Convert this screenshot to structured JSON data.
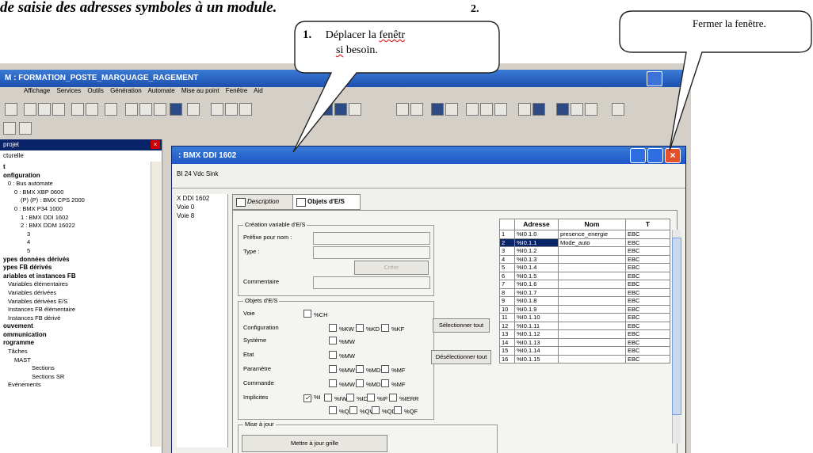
{
  "doc_heading": "de saisie des adresses symboles à un module.",
  "app": {
    "title": "M : FORMATION_POSTE_MARQUAGE_RAGEMENT",
    "menu": [
      "Affichage",
      "Services",
      "Outils",
      "Génération",
      "Automate",
      "Mise au point",
      "Fenêtre",
      "Aid"
    ]
  },
  "left_panel": {
    "title": "projet",
    "close": "×",
    "subtitle": "cturelle",
    "tree": [
      {
        "text": "t",
        "bold": true
      },
      {
        "text": "onfiguration",
        "bold": true
      },
      {
        "text": "0 : Bus automate",
        "bold": false
      },
      {
        "text": "0 : BMX XBP 0600",
        "bold": false
      },
      {
        "text": "(P) (P) : BMX CPS 2000",
        "bold": false
      },
      {
        "text": "0 : BMX P34 1000",
        "bold": false
      },
      {
        "text": "1 : BMX DDI 1602",
        "bold": false
      },
      {
        "text": "2 : BMX DDM 16022",
        "bold": false
      },
      {
        "text": "3",
        "bold": false
      },
      {
        "text": "4",
        "bold": false
      },
      {
        "text": "5",
        "bold": false
      },
      {
        "text": "ypes données dérivés",
        "bold": true
      },
      {
        "text": "ypes FB dérivés",
        "bold": true
      },
      {
        "text": "ariables et instances FB",
        "bold": true
      },
      {
        "text": "Variables élémentaires",
        "bold": false
      },
      {
        "text": "Variables dérivées",
        "bold": false
      },
      {
        "text": "Variables dérivées E/S",
        "bold": false
      },
      {
        "text": "Instances FB élémentaire",
        "bold": false
      },
      {
        "text": "Instances FB dérivé",
        "bold": false
      },
      {
        "text": "ouvement",
        "bold": true
      },
      {
        "text": "ommunication",
        "bold": true
      },
      {
        "text": "rogramme",
        "bold": true
      },
      {
        "text": "Tâches",
        "bold": false
      },
      {
        "text": "MAST",
        "bold": false
      },
      {
        "text": "Sections",
        "bold": false
      },
      {
        "text": "Sections SR",
        "bold": false
      },
      {
        "text": "Evénements",
        "bold": false
      }
    ]
  },
  "dialog": {
    "title": ": BMX DDI 1602",
    "subtitle": "BI 24 Vdc Sink",
    "close_glyph": "×",
    "channels": [
      "X DDI 1602",
      "Voie 0",
      "Voie 8"
    ],
    "tabs": [
      "Description",
      "Objets d'E/S"
    ],
    "creation_group": "Création variable d'E/S",
    "prefix_label": "Préfixe pour nom :",
    "type_label": "Type :",
    "create_button": "Créer",
    "comment_label": "Commentaire",
    "objects_group": "Objets d'E/S",
    "rows": {
      "voie": "Voie",
      "configuration": "Configuration",
      "systeme": "Système",
      "etat": "Etat",
      "parametre": "Paramètre",
      "commande": "Commande",
      "implicites": "Implicites"
    },
    "cb": {
      "ch": "%CH",
      "kw": "%KW",
      "kd": "%KD",
      "kf": "%KF",
      "mw_sys": "%MW",
      "mw_etat": "%MW",
      "mw_par": "%MW",
      "md_par": "%MD",
      "mf_par": "%MF",
      "mw_cmd": "%MW",
      "md_cmd": "%MD",
      "mf_cmd": "%MF",
      "i": "%I",
      "iw": "%IW",
      "id": "%ID",
      "if": "%IF",
      "ierr": "%IERR",
      "q": "%Q",
      "qw": "%QW",
      "qd": "%QD",
      "qf": "%QF"
    },
    "select_all": "Sélectionner tout",
    "deselect_all": "Désélectionner tout",
    "update_group": "Mise à jour",
    "update_button": "Mettre à jour grille"
  },
  "io_table": {
    "headers": [
      "",
      "Adresse",
      "Nom",
      "T"
    ],
    "rows": [
      {
        "n": "1",
        "addr": "%I0.1.0",
        "name": "presence_energie",
        "t": "EBC"
      },
      {
        "n": "2",
        "addr": "%I0.1.1",
        "name": "Mode_auto",
        "t": "EBC",
        "selected": true
      },
      {
        "n": "3",
        "addr": "%I0.1.2",
        "name": "",
        "t": "EBC"
      },
      {
        "n": "4",
        "addr": "%I0.1.3",
        "name": "",
        "t": "EBC"
      },
      {
        "n": "5",
        "addr": "%I0.1.4",
        "name": "",
        "t": "EBC"
      },
      {
        "n": "6",
        "addr": "%I0.1.5",
        "name": "",
        "t": "EBC"
      },
      {
        "n": "7",
        "addr": "%I0.1.6",
        "name": "",
        "t": "EBC"
      },
      {
        "n": "8",
        "addr": "%I0.1.7",
        "name": "",
        "t": "EBC"
      },
      {
        "n": "9",
        "addr": "%I0.1.8",
        "name": "",
        "t": "EBC"
      },
      {
        "n": "10",
        "addr": "%I0.1.9",
        "name": "",
        "t": "EBC"
      },
      {
        "n": "11",
        "addr": "%I0.1.10",
        "name": "",
        "t": "EBC"
      },
      {
        "n": "12",
        "addr": "%I0.1.11",
        "name": "",
        "t": "EBC"
      },
      {
        "n": "13",
        "addr": "%I0.1.12",
        "name": "",
        "t": "EBC"
      },
      {
        "n": "14",
        "addr": "%I0.1.13",
        "name": "",
        "t": "EBC"
      },
      {
        "n": "15",
        "addr": "%I0.1.14",
        "name": "",
        "t": "EBC"
      },
      {
        "n": "16",
        "addr": "%I0.1.15",
        "name": "",
        "t": "EBC"
      }
    ]
  },
  "callouts": {
    "move_number": "1.",
    "move_text_a": "Déplacer la ",
    "move_text_b": "fenêtr",
    "move_text_c": "si",
    "move_text_d": " besoin.",
    "close_number": "2.",
    "close_text": "Fermer la fenêtre."
  }
}
